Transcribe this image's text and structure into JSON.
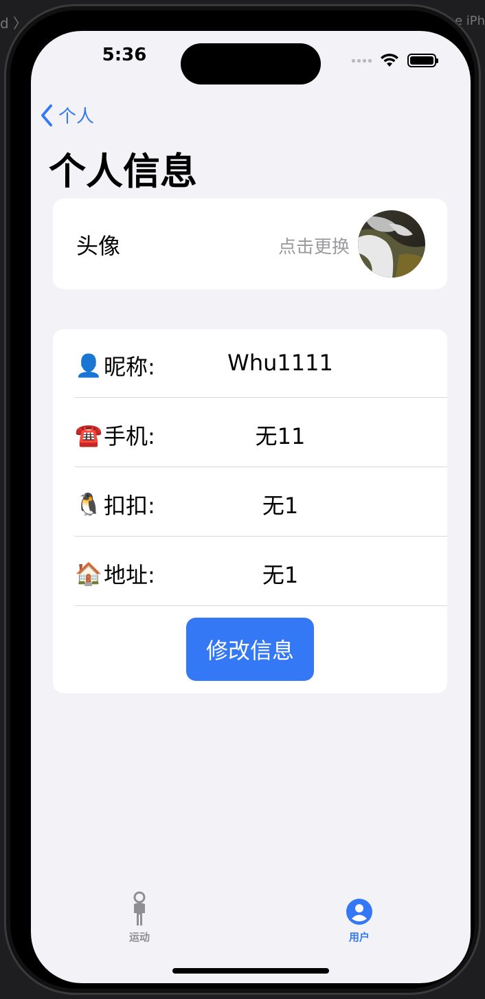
{
  "ide": {
    "left_text": "d 〉",
    "right_text": "e iPh"
  },
  "status_bar": {
    "time": "5:36"
  },
  "nav": {
    "back_label": "个人",
    "title": "个人信息"
  },
  "avatar_card": {
    "label": "头像",
    "hint": "点击更换"
  },
  "info": {
    "rows": [
      {
        "emoji": "👤",
        "label": "昵称:",
        "value": "Whu1111"
      },
      {
        "emoji": "☎️",
        "label": "手机:",
        "value": "无11"
      },
      {
        "emoji": "🐧",
        "label": "扣扣:",
        "value": "无1"
      },
      {
        "emoji": "🏠",
        "label": "地址:",
        "value": "无1"
      }
    ],
    "edit_button": "修改信息"
  },
  "tab_bar": {
    "tabs": [
      {
        "label": "运动",
        "icon": "figure-walk-icon",
        "selected": false
      },
      {
        "label": "用户",
        "icon": "person-circle-icon",
        "selected": true
      }
    ]
  },
  "colors": {
    "accent": "#3478f6",
    "background": "#f2f2f7",
    "card": "#ffffff",
    "secondary_text": "#9a9a9f"
  }
}
